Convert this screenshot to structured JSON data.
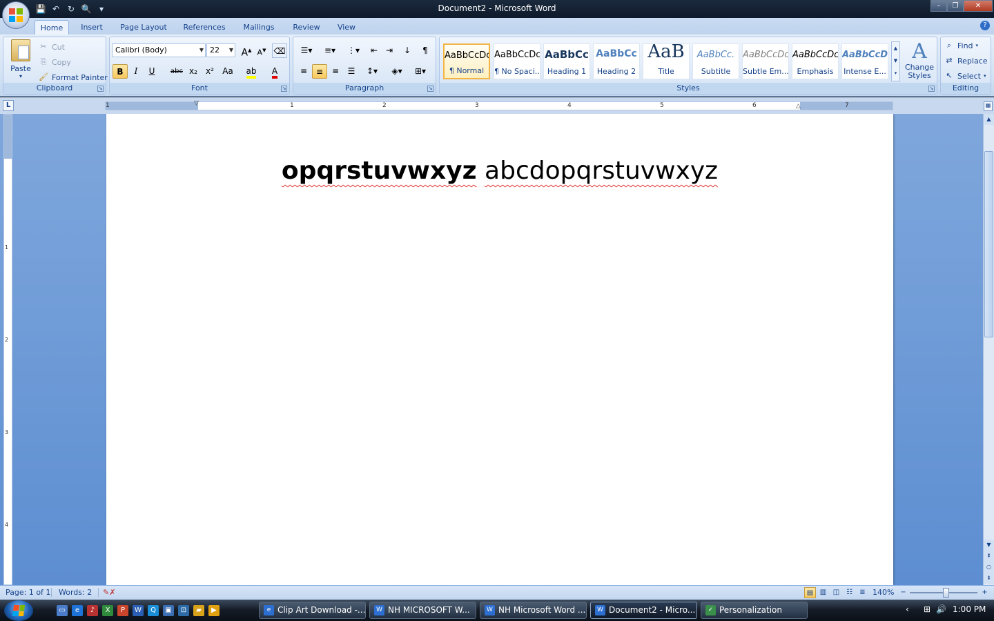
{
  "window": {
    "title": "Document2 - Microsoft Word",
    "minimize": "–",
    "maximize": "❐",
    "close": "✕"
  },
  "qat": {
    "save": "💾",
    "undo": "↶",
    "redo": "↻",
    "preview": "🔍",
    "customize": "▾"
  },
  "tabs": [
    "Home",
    "Insert",
    "Page Layout",
    "References",
    "Mailings",
    "Review",
    "View"
  ],
  "ribbon": {
    "clipboard": {
      "label": "Clipboard",
      "paste": "Paste",
      "cut": "Cut",
      "copy": "Copy",
      "format_painter": "Format Painter"
    },
    "font": {
      "label": "Font",
      "family": "Calibri (Body)",
      "size": "22",
      "bold": "B",
      "italic": "I",
      "underline": "U",
      "strike": "abc",
      "subscript": "x₂",
      "superscript": "x²",
      "change_case": "Aa",
      "grow": "A",
      "shrink": "A"
    },
    "paragraph": {
      "label": "Paragraph",
      "pilcrow": "¶"
    },
    "styles": {
      "label": "Styles",
      "items": [
        {
          "sample": "AaBbCcDc",
          "name": "¶ Normal"
        },
        {
          "sample": "AaBbCcDc",
          "name": "¶ No Spaci..."
        },
        {
          "sample": "AaBbCc",
          "name": "Heading 1"
        },
        {
          "sample": "AaBbCc",
          "name": "Heading 2"
        },
        {
          "sample": "AaB",
          "name": "Title"
        },
        {
          "sample": "AaBbCc.",
          "name": "Subtitle"
        },
        {
          "sample": "AaBbCcDc",
          "name": "Subtle Em..."
        },
        {
          "sample": "AaBbCcDc",
          "name": "Emphasis"
        },
        {
          "sample": "AaBbCcDc",
          "name": "Intense E..."
        }
      ],
      "change_styles": "Change Styles"
    },
    "editing": {
      "label": "Editing",
      "find": "Find",
      "replace": "Replace",
      "select": "Select"
    }
  },
  "ruler": {
    "corner": "L",
    "numbers": [
      "1",
      "1",
      "2",
      "3",
      "4",
      "5",
      "6",
      "7"
    ],
    "vnumbers": [
      "1",
      "2",
      "3",
      "4"
    ]
  },
  "document": {
    "bold_text": "opqrstuvwxyz",
    "normal_text": "abcdopqrstuvwxyz"
  },
  "status": {
    "page": "Page: 1 of 1",
    "words": "Words: 2",
    "zoom": "140%"
  },
  "taskbar": {
    "tasks": [
      {
        "label": "Clip Art Download -..."
      },
      {
        "label": "NH MICROSOFT W..."
      },
      {
        "label": "NH Microsoft Word ..."
      },
      {
        "label": "Document2 - Micro..."
      },
      {
        "label": "Personalization"
      }
    ],
    "clock": "1:00 PM"
  }
}
